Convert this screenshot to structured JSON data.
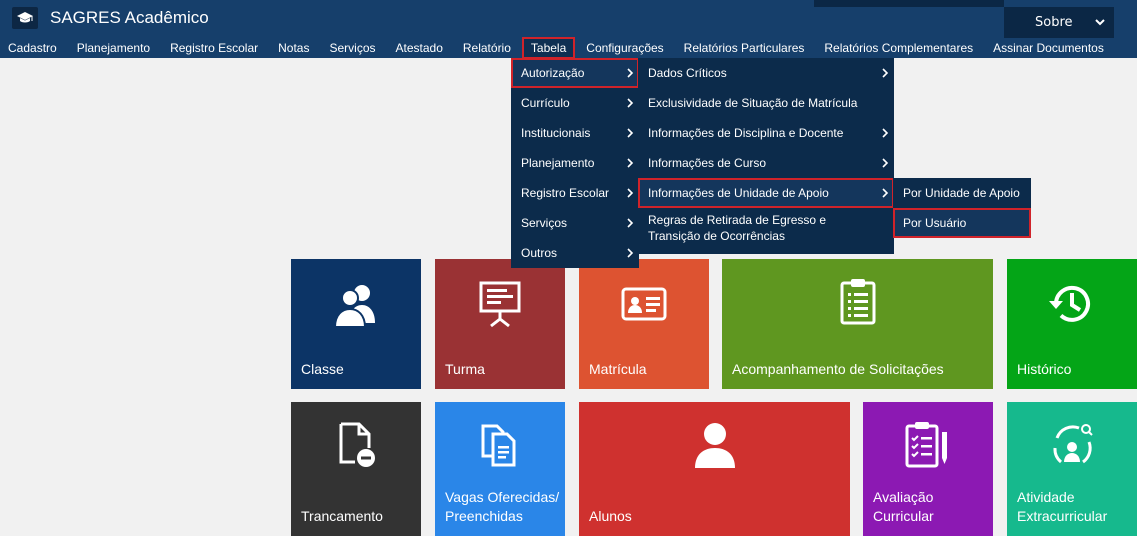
{
  "app": {
    "title": "SAGRES Acadêmico",
    "logo_icon": "graduation-cap-icon"
  },
  "header": {
    "sobre_label": "Sobre"
  },
  "nav": [
    {
      "label": "Cadastro"
    },
    {
      "label": "Planejamento"
    },
    {
      "label": "Registro Escolar"
    },
    {
      "label": "Notas"
    },
    {
      "label": "Serviços"
    },
    {
      "label": "Atestado"
    },
    {
      "label": "Relatório"
    },
    {
      "label": "Tabela",
      "active": true
    },
    {
      "label": "Configurações"
    },
    {
      "label": "Relatórios Particulares"
    },
    {
      "label": "Relatórios Complementares"
    },
    {
      "label": "Assinar Documentos"
    }
  ],
  "menu1": [
    {
      "label": "Autorização",
      "highlighted": true
    },
    {
      "label": "Currículo"
    },
    {
      "label": "Institucionais"
    },
    {
      "label": "Planejamento"
    },
    {
      "label": "Registro Escolar"
    },
    {
      "label": "Serviços"
    },
    {
      "label": "Outros"
    }
  ],
  "menu2": [
    {
      "label": "Dados Críticos",
      "has_sub": true
    },
    {
      "label": "Exclusividade de Situação de Matrícula",
      "has_sub": false
    },
    {
      "label": "Informações de Disciplina e Docente",
      "has_sub": true
    },
    {
      "label": "Informações de Curso",
      "has_sub": true
    },
    {
      "label": "Informações de Unidade de Apoio",
      "has_sub": true,
      "highlighted": true
    },
    {
      "label": "Regras de Retirada de Egresso e Transição de Ocorrências",
      "has_sub": false
    }
  ],
  "menu3": [
    {
      "label": "Por Unidade de Apoio"
    },
    {
      "label": "Por Usuário",
      "highlighted": true
    }
  ],
  "tiles": [
    {
      "label": "Classe",
      "color": "#0c3466",
      "icon": "users-icon"
    },
    {
      "label": "Turma",
      "color": "#9a3234",
      "icon": "presentation-board-icon"
    },
    {
      "label": "Matrícula",
      "color": "#dd5331",
      "icon": "id-card-icon"
    },
    {
      "label": "Acompanhamento de Solicitações",
      "color": "#5f9720",
      "icon": "clipboard-list-icon"
    },
    {
      "label": "Histórico",
      "color": "#04a517",
      "icon": "history-clock-icon"
    },
    {
      "label": "Trancamento",
      "color": "#333333",
      "icon": "file-remove-icon"
    },
    {
      "label": "Vagas Oferecidas/ Preenchidas",
      "color": "#2a86e8",
      "icon": "documents-icon"
    },
    {
      "label": "Alunos",
      "color": "#cf312f",
      "icon": "user-icon"
    },
    {
      "label": "Avaliação Curricular",
      "color": "#8c19b3",
      "icon": "checklist-pen-icon"
    },
    {
      "label": "Atividade Extracurricular",
      "color": "#16b98d",
      "icon": "user-cycle-icon"
    }
  ]
}
